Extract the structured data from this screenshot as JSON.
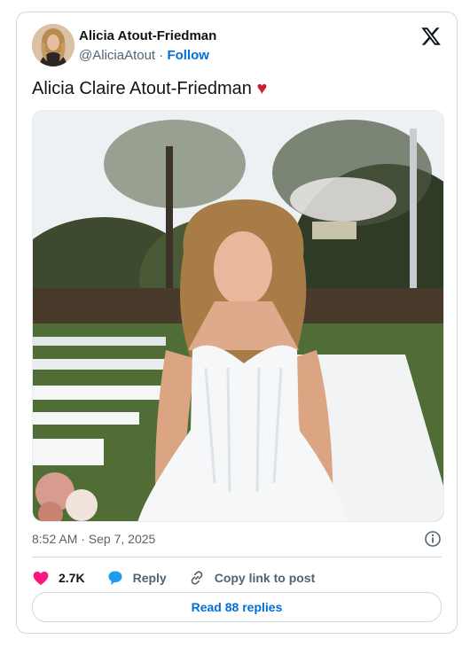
{
  "author": {
    "name": "Alicia Atout-Friedman",
    "handle": "@AliciaAtout",
    "separator": "·",
    "follow_label": "Follow"
  },
  "tweet": {
    "text": "Alicia Claire Atout-Friedman",
    "emoji": "♥"
  },
  "timestamp": "8:52 AM · Sep 7, 2025",
  "actions": {
    "likes": "2.7K",
    "reply_label": "Reply",
    "copy_link_label": "Copy link to post"
  },
  "read_replies_label": "Read 88 replies",
  "colors": {
    "like": "#f91880",
    "reply": "#1d9bf0",
    "link": "#006fd6",
    "text": "#0f1419",
    "muted": "#536471"
  },
  "icons": [
    "x-logo-icon",
    "info-icon",
    "heart-icon",
    "reply-bubble-icon",
    "link-icon"
  ]
}
